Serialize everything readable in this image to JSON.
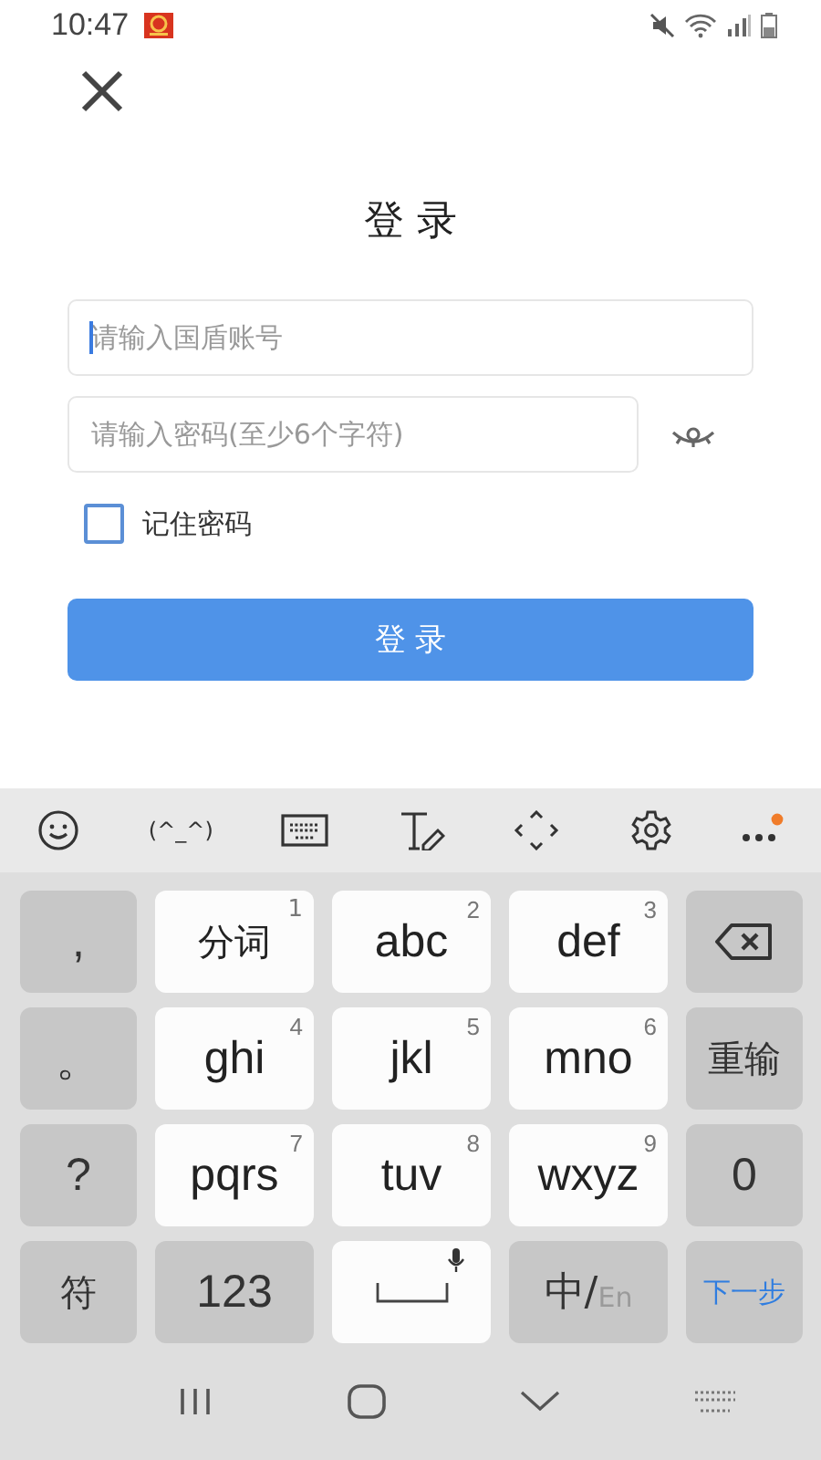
{
  "status_bar": {
    "time": "10:47"
  },
  "title": "登 录",
  "username": {
    "placeholder": "请输入国盾账号",
    "focused": true
  },
  "password": {
    "placeholder": "请输入密码(至少6个字符)"
  },
  "remember": {
    "label": "记住密码",
    "checked": false
  },
  "login_button": "登 录",
  "keyboard_toolbar": {
    "kaomoji": "(^_^)"
  },
  "keys": [
    {
      "kind": "func",
      "label": ","
    },
    {
      "kind": "letter",
      "label": "分词",
      "digit": "1"
    },
    {
      "kind": "letter",
      "label": "abc",
      "digit": "2"
    },
    {
      "kind": "letter",
      "label": "def",
      "digit": "3"
    },
    {
      "kind": "backspace"
    },
    {
      "kind": "func",
      "label": "。"
    },
    {
      "kind": "letter",
      "label": "ghi",
      "digit": "4"
    },
    {
      "kind": "letter",
      "label": "jkl",
      "digit": "5"
    },
    {
      "kind": "letter",
      "label": "mno",
      "digit": "6"
    },
    {
      "kind": "func",
      "label": "重输"
    },
    {
      "kind": "func",
      "label": "?"
    },
    {
      "kind": "letter",
      "label": "pqrs",
      "digit": "7"
    },
    {
      "kind": "letter",
      "label": "tuv",
      "digit": "8"
    },
    {
      "kind": "letter",
      "label": "wxyz",
      "digit": "9"
    },
    {
      "kind": "func",
      "label": "0"
    },
    {
      "kind": "func",
      "label": "符"
    },
    {
      "kind": "func",
      "label": "123"
    },
    {
      "kind": "space"
    },
    {
      "kind": "lang",
      "label": "中/",
      "alt": "En"
    },
    {
      "kind": "action",
      "label": "下一步"
    }
  ]
}
